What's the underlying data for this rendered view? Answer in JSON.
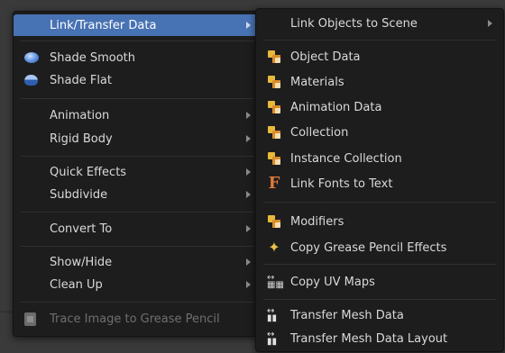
{
  "left_menu": {
    "items": [
      {
        "label": "Link/Transfer Data",
        "has_submenu": true,
        "highlighted": true
      },
      {
        "label": "Shade Smooth",
        "icon": "shade-smooth-icon"
      },
      {
        "label": "Shade Flat",
        "icon": "shade-flat-icon"
      },
      {
        "label": "Animation",
        "has_submenu": true
      },
      {
        "label": "Rigid Body",
        "has_submenu": true
      },
      {
        "label": "Quick Effects",
        "has_submenu": true
      },
      {
        "label": "Subdivide",
        "has_submenu": true
      },
      {
        "label": "Convert To",
        "has_submenu": true
      },
      {
        "label": "Show/Hide",
        "has_submenu": true
      },
      {
        "label": "Clean Up",
        "has_submenu": true
      },
      {
        "label": "Trace Image to Grease Pencil",
        "icon": "image-icon",
        "disabled": true
      }
    ]
  },
  "right_menu": {
    "items": [
      {
        "label": "Link Objects to Scene",
        "has_submenu": true
      },
      {
        "label": "Object Data",
        "icon": "object-data-icon"
      },
      {
        "label": "Materials",
        "icon": "materials-icon"
      },
      {
        "label": "Animation Data",
        "icon": "animation-data-icon"
      },
      {
        "label": "Collection",
        "icon": "collection-icon"
      },
      {
        "label": "Instance Collection",
        "icon": "instance-collection-icon"
      },
      {
        "label": "Link Fonts to Text",
        "icon": "font-icon"
      },
      {
        "label": "Modifiers",
        "icon": "modifiers-icon"
      },
      {
        "label": "Copy Grease Pencil Effects",
        "icon": "sparkle-icon"
      },
      {
        "label": "Copy UV Maps",
        "icon": "uv-maps-icon"
      },
      {
        "label": "Transfer Mesh Data",
        "icon": "transfer-icon"
      },
      {
        "label": "Transfer Mesh Data Layout",
        "icon": "transfer-layout-icon"
      }
    ]
  },
  "colors": {
    "menu_bg": "#1d1d1d",
    "highlight": "#4772b3",
    "text": "#d9d9d9",
    "disabled_text": "#6f6f6f"
  }
}
